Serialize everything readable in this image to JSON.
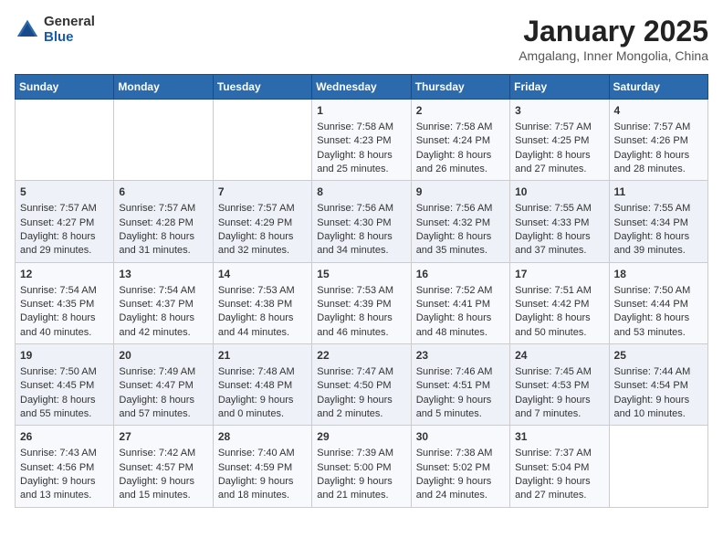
{
  "app": {
    "logo_general": "General",
    "logo_blue": "Blue"
  },
  "header": {
    "title": "January 2025",
    "subtitle": "Amgalang, Inner Mongolia, China"
  },
  "days_of_week": [
    "Sunday",
    "Monday",
    "Tuesday",
    "Wednesday",
    "Thursday",
    "Friday",
    "Saturday"
  ],
  "weeks": [
    [
      {
        "day": "",
        "content": ""
      },
      {
        "day": "",
        "content": ""
      },
      {
        "day": "",
        "content": ""
      },
      {
        "day": "1",
        "content": "Sunrise: 7:58 AM\nSunset: 4:23 PM\nDaylight: 8 hours\nand 25 minutes."
      },
      {
        "day": "2",
        "content": "Sunrise: 7:58 AM\nSunset: 4:24 PM\nDaylight: 8 hours\nand 26 minutes."
      },
      {
        "day": "3",
        "content": "Sunrise: 7:57 AM\nSunset: 4:25 PM\nDaylight: 8 hours\nand 27 minutes."
      },
      {
        "day": "4",
        "content": "Sunrise: 7:57 AM\nSunset: 4:26 PM\nDaylight: 8 hours\nand 28 minutes."
      }
    ],
    [
      {
        "day": "5",
        "content": "Sunrise: 7:57 AM\nSunset: 4:27 PM\nDaylight: 8 hours\nand 29 minutes."
      },
      {
        "day": "6",
        "content": "Sunrise: 7:57 AM\nSunset: 4:28 PM\nDaylight: 8 hours\nand 31 minutes."
      },
      {
        "day": "7",
        "content": "Sunrise: 7:57 AM\nSunset: 4:29 PM\nDaylight: 8 hours\nand 32 minutes."
      },
      {
        "day": "8",
        "content": "Sunrise: 7:56 AM\nSunset: 4:30 PM\nDaylight: 8 hours\nand 34 minutes."
      },
      {
        "day": "9",
        "content": "Sunrise: 7:56 AM\nSunset: 4:32 PM\nDaylight: 8 hours\nand 35 minutes."
      },
      {
        "day": "10",
        "content": "Sunrise: 7:55 AM\nSunset: 4:33 PM\nDaylight: 8 hours\nand 37 minutes."
      },
      {
        "day": "11",
        "content": "Sunrise: 7:55 AM\nSunset: 4:34 PM\nDaylight: 8 hours\nand 39 minutes."
      }
    ],
    [
      {
        "day": "12",
        "content": "Sunrise: 7:54 AM\nSunset: 4:35 PM\nDaylight: 8 hours\nand 40 minutes."
      },
      {
        "day": "13",
        "content": "Sunrise: 7:54 AM\nSunset: 4:37 PM\nDaylight: 8 hours\nand 42 minutes."
      },
      {
        "day": "14",
        "content": "Sunrise: 7:53 AM\nSunset: 4:38 PM\nDaylight: 8 hours\nand 44 minutes."
      },
      {
        "day": "15",
        "content": "Sunrise: 7:53 AM\nSunset: 4:39 PM\nDaylight: 8 hours\nand 46 minutes."
      },
      {
        "day": "16",
        "content": "Sunrise: 7:52 AM\nSunset: 4:41 PM\nDaylight: 8 hours\nand 48 minutes."
      },
      {
        "day": "17",
        "content": "Sunrise: 7:51 AM\nSunset: 4:42 PM\nDaylight: 8 hours\nand 50 minutes."
      },
      {
        "day": "18",
        "content": "Sunrise: 7:50 AM\nSunset: 4:44 PM\nDaylight: 8 hours\nand 53 minutes."
      }
    ],
    [
      {
        "day": "19",
        "content": "Sunrise: 7:50 AM\nSunset: 4:45 PM\nDaylight: 8 hours\nand 55 minutes."
      },
      {
        "day": "20",
        "content": "Sunrise: 7:49 AM\nSunset: 4:47 PM\nDaylight: 8 hours\nand 57 minutes."
      },
      {
        "day": "21",
        "content": "Sunrise: 7:48 AM\nSunset: 4:48 PM\nDaylight: 9 hours\nand 0 minutes."
      },
      {
        "day": "22",
        "content": "Sunrise: 7:47 AM\nSunset: 4:50 PM\nDaylight: 9 hours\nand 2 minutes."
      },
      {
        "day": "23",
        "content": "Sunrise: 7:46 AM\nSunset: 4:51 PM\nDaylight: 9 hours\nand 5 minutes."
      },
      {
        "day": "24",
        "content": "Sunrise: 7:45 AM\nSunset: 4:53 PM\nDaylight: 9 hours\nand 7 minutes."
      },
      {
        "day": "25",
        "content": "Sunrise: 7:44 AM\nSunset: 4:54 PM\nDaylight: 9 hours\nand 10 minutes."
      }
    ],
    [
      {
        "day": "26",
        "content": "Sunrise: 7:43 AM\nSunset: 4:56 PM\nDaylight: 9 hours\nand 13 minutes."
      },
      {
        "day": "27",
        "content": "Sunrise: 7:42 AM\nSunset: 4:57 PM\nDaylight: 9 hours\nand 15 minutes."
      },
      {
        "day": "28",
        "content": "Sunrise: 7:40 AM\nSunset: 4:59 PM\nDaylight: 9 hours\nand 18 minutes."
      },
      {
        "day": "29",
        "content": "Sunrise: 7:39 AM\nSunset: 5:00 PM\nDaylight: 9 hours\nand 21 minutes."
      },
      {
        "day": "30",
        "content": "Sunrise: 7:38 AM\nSunset: 5:02 PM\nDaylight: 9 hours\nand 24 minutes."
      },
      {
        "day": "31",
        "content": "Sunrise: 7:37 AM\nSunset: 5:04 PM\nDaylight: 9 hours\nand 27 minutes."
      },
      {
        "day": "",
        "content": ""
      }
    ]
  ]
}
